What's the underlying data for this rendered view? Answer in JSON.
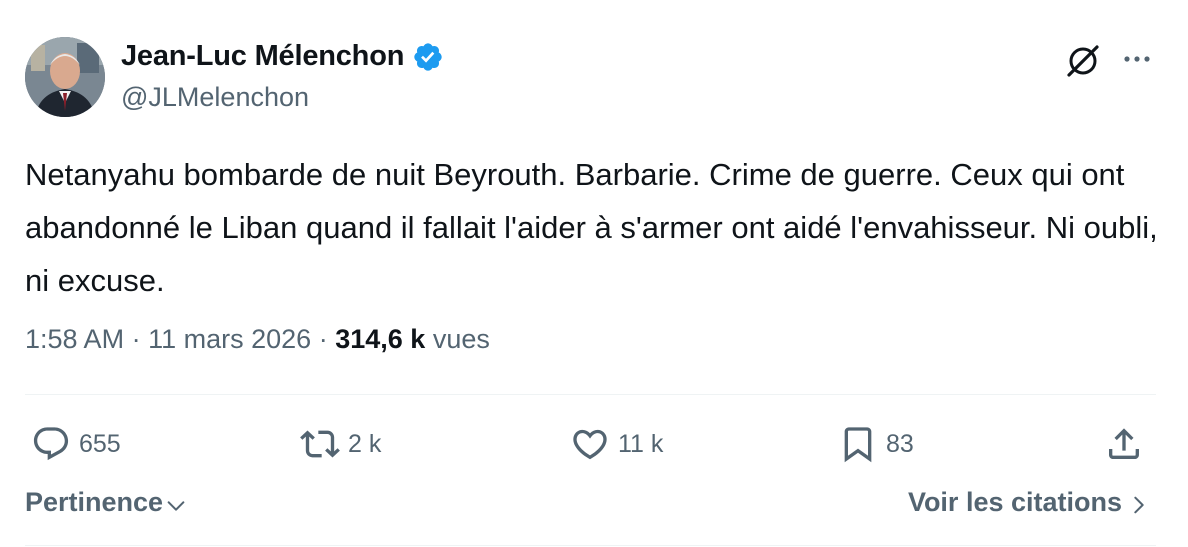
{
  "author": {
    "name": "Jean-Luc Mélenchon",
    "handle": "@JLMelenchon",
    "verified_icon": "verified-badge-icon"
  },
  "tweet": {
    "text": "Netanyahu bombarde de nuit Beyrouth. Barbarie. Crime de guerre. Ceux qui ont abandonné le Liban quand il fallait l'aider à s'armer ont aidé l'envahisseur. Ni oubli, ni excuse.",
    "time": "1:58 AM",
    "date": "11 mars 2026",
    "views_count": "314,6 k",
    "views_label": "vues"
  },
  "actions": {
    "replies": "655",
    "reposts": "2 k",
    "likes": "11 k",
    "bookmarks": "83"
  },
  "footer": {
    "sort_label": "Pertinence",
    "quotes_label": "Voir les citations"
  },
  "colors": {
    "text_primary": "#0f1419",
    "text_secondary": "#536471",
    "verified_blue": "#1d9bf0",
    "divider": "#eff3f4"
  }
}
